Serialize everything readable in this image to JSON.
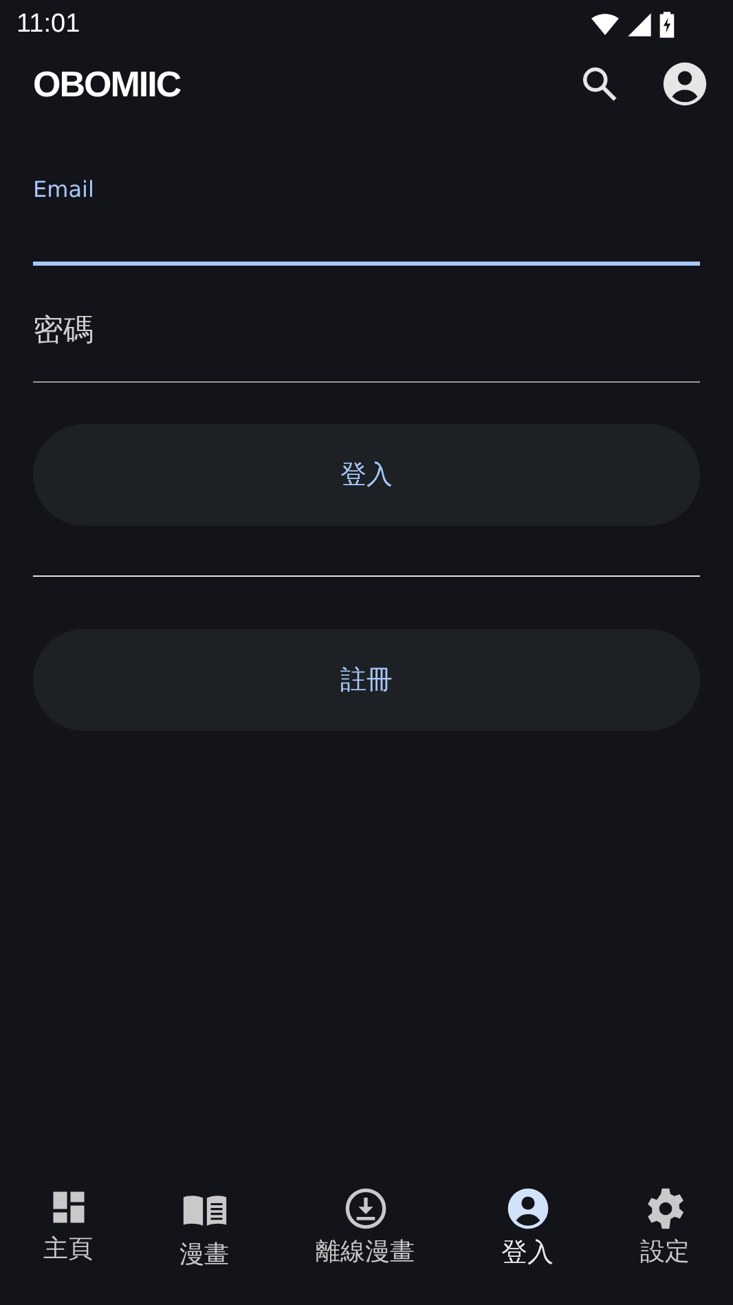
{
  "status_bar": {
    "time": "11:01"
  },
  "app_bar": {
    "logo": "OBOMIIC"
  },
  "form": {
    "fields": [
      {
        "label": "Email",
        "focused": true
      },
      {
        "label": "密碼",
        "focused": false
      }
    ],
    "login_button": "登入",
    "register_button": "註冊"
  },
  "bottom_nav": [
    {
      "label": "主頁",
      "selected": false
    },
    {
      "label": "漫畫",
      "selected": false
    },
    {
      "label": "離線漫畫",
      "selected": false
    },
    {
      "label": "登入",
      "selected": true
    },
    {
      "label": "設定",
      "selected": false
    }
  ]
}
